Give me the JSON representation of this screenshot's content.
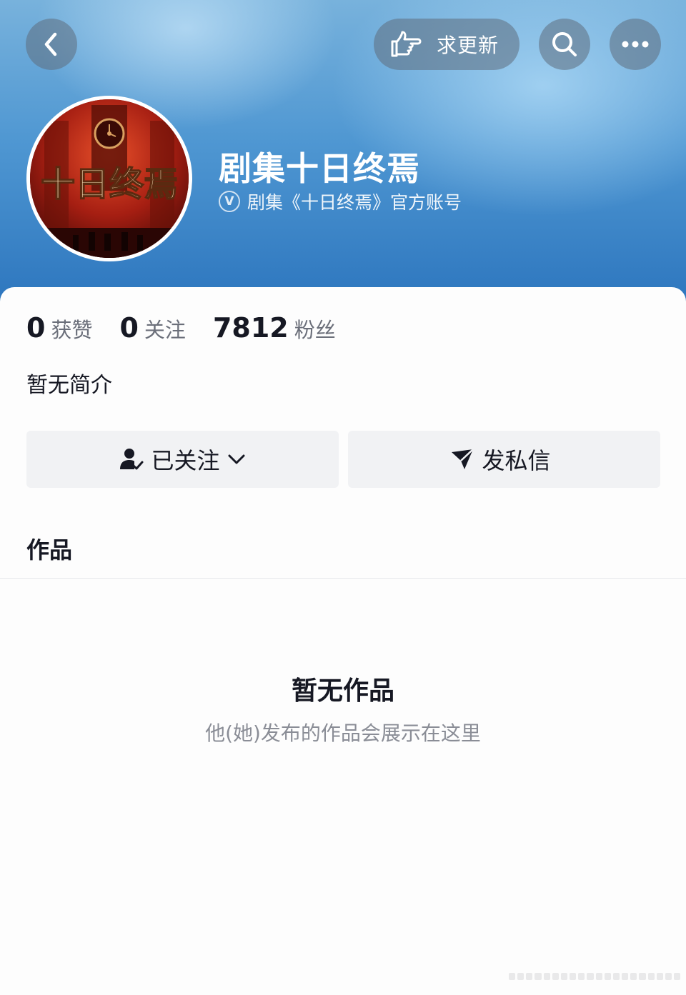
{
  "header": {
    "request_update_label": "求更新",
    "icons": [
      "back-icon",
      "pointing-hand-icon",
      "search-icon",
      "more-icon"
    ]
  },
  "profile": {
    "name": "剧集十日终焉",
    "verify_badge": "V",
    "verified_text": "剧集《十日终焉》官方账号",
    "avatar_text": "十日终焉"
  },
  "stats": {
    "likes_count": "0",
    "likes_label": "获赞",
    "following_count": "0",
    "following_label": "关注",
    "followers_count": "7812",
    "followers_label": "粉丝"
  },
  "bio": "暂无简介",
  "actions": {
    "follow_label": "已关注",
    "message_label": "发私信"
  },
  "tabs": {
    "works_label": "作品"
  },
  "empty": {
    "title": "暂无作品",
    "subtitle": "他(她)发布的作品会展示在这里"
  },
  "colors": {
    "header_blue": "#4f97d2",
    "button_gray": "#f1f2f4",
    "text_primary": "#161823",
    "text_secondary": "#8a8d96"
  }
}
